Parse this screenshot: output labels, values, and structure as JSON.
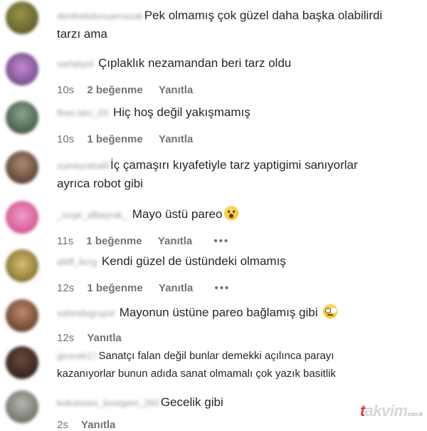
{
  "comments": [
    {
      "user": "denthekdunuarcezak",
      "text": "Pek olmamış çok güzel daha başka olabilirdi",
      "text2": "tarzı ama",
      "avatar": "#6b6a2e"
    },
    {
      "user": "sarlakyol",
      "text": "Çıplaklık nezamandan beri tarz oldu",
      "time": "10s",
      "likes": "2 beğenme",
      "reply": "Yanıtla",
      "avatar": "#8a5b9a"
    },
    {
      "user": "ftren.blrc_03",
      "text": "Hiç hoş değil yakışmamış",
      "time": "10s",
      "likes": "1 beğenme",
      "reply": "Yanıtla",
      "avatar": "#4f6a55"
    },
    {
      "user": "sumeyrahalil",
      "text": "İç çamaşırı kıyafetiyle tarz yaptigimi sanıyorlar",
      "text2": "ayrıca robot gibi",
      "avatar": "#6a5044"
    },
    {
      "user": "_ozge_albayrak_",
      "text": "Mayo üstü pareo",
      "time": "11s",
      "likes": "1 beğenme",
      "reply": "Yanıtla",
      "dots": "•••",
      "avatar": "#d75d9a"
    },
    {
      "user": "altiff_bcrg",
      "text": "Kendi güzel de üstündeki olmamış",
      "time": "12s",
      "likes": "1 beğenme",
      "reply": "Yanıtla",
      "dots": "•••",
      "avatar": "#9a8640"
    },
    {
      "user": "sahindogruyoi",
      "text": "Mayonun üstüne pareo bağlamış gibi",
      "time": "12s",
      "reply": "Yanıtla",
      "avatar": "#7b4d3a"
    },
    {
      "user": "girocek17",
      "text": "Sanatçı falan değil bunlar demekki açılınca parayı",
      "text2": "kazanıyorlar bunun adıda sanat olmamalı çok yazık basitlik",
      "avatar": "#3b2a22"
    },
    {
      "user": "kokuloses_bostgem_260",
      "text": "Gecelik gibi",
      "time": "2s",
      "reply": "Yanıtla",
      "avatar": "#8c8a84"
    }
  ],
  "watermark": {
    "brand": "takvim",
    "domain": "com.tr"
  }
}
